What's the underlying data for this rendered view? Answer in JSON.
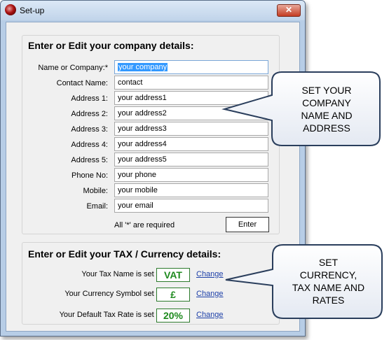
{
  "window": {
    "title": "Set-up",
    "close_glyph": "✕"
  },
  "company": {
    "group_title": "Enter or Edit your company details:",
    "fields": [
      {
        "label": "Name or Company:*",
        "value": "your company"
      },
      {
        "label": "Contact Name:",
        "value": "contact"
      },
      {
        "label": "Address 1:",
        "value": "your address1"
      },
      {
        "label": "Address 2:",
        "value": "your address2"
      },
      {
        "label": "Address 3:",
        "value": "your address3"
      },
      {
        "label": "Address 4:",
        "value": "your address4"
      },
      {
        "label": "Address 5:",
        "value": "your address5"
      },
      {
        "label": "Phone No:",
        "value": "your phone"
      },
      {
        "label": "Mobile:",
        "value": "your mobile"
      },
      {
        "label": "Email:",
        "value": "your email"
      }
    ],
    "required_note": "All '*' are required",
    "enter_label": "Enter"
  },
  "tax": {
    "group_title": "Enter or Edit your TAX / Currency  details:",
    "rows": [
      {
        "label": "Your Tax Name is set to:",
        "value": "VAT",
        "link": "Change"
      },
      {
        "label": "Your Currency Symbol set to:",
        "value": "£",
        "link": "Change"
      },
      {
        "label": "Your Default Tax Rate is  set to:",
        "value": "20%",
        "link": "Change"
      }
    ]
  },
  "callouts": {
    "company": [
      "SET YOUR",
      "COMPANY",
      "NAME AND",
      "ADDRESS"
    ],
    "tax": [
      "SET",
      "CURRENCY,",
      "TAX NAME AND",
      "RATES"
    ]
  },
  "icons": {
    "app": "app-logo-icon",
    "close": "close-icon"
  }
}
